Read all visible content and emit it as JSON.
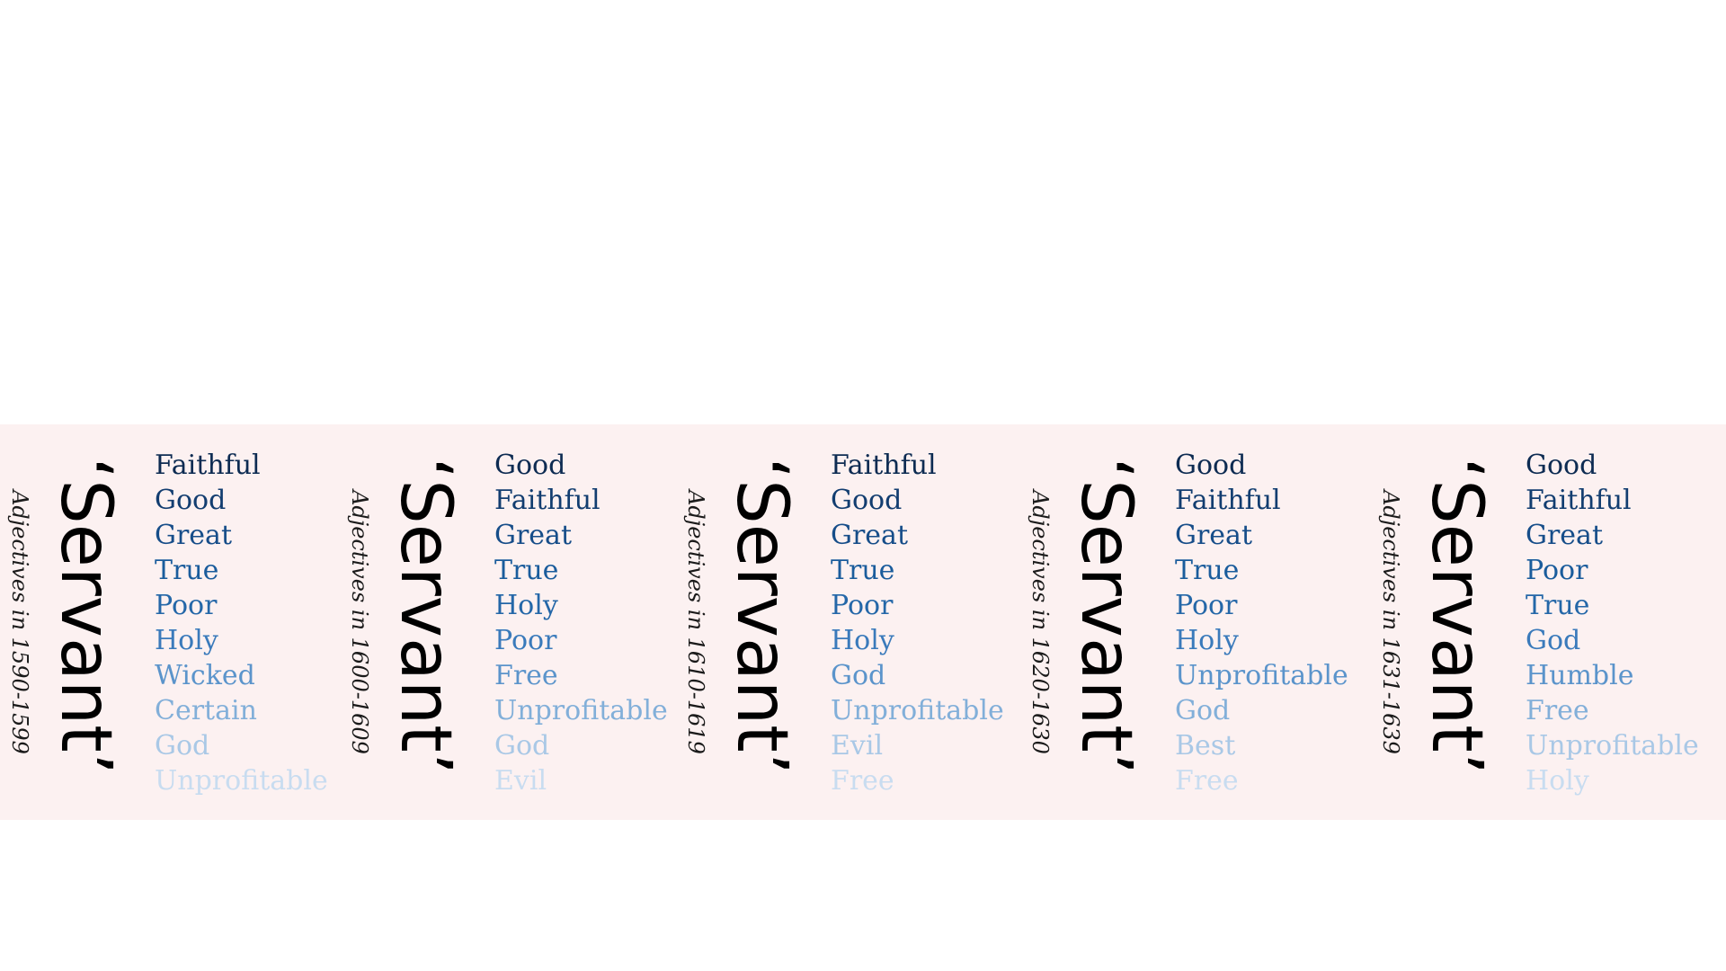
{
  "palette": [
    "#0d2b52",
    "#123d70",
    "#164d89",
    "#1a5c9c",
    "#2467a8",
    "#3a7abb",
    "#5b94cb",
    "#82afd9",
    "#a9c8e6",
    "#c8dcf0"
  ],
  "panels": [
    {
      "period": "Adjectives in 1590-1599",
      "word": "‘Servant’",
      "adjectives": [
        "Faithful",
        "Good",
        "Great",
        "True",
        "Poor",
        "Holy",
        "Wicked",
        "Certain",
        "God",
        "Unprofitable"
      ]
    },
    {
      "period": "Adjectives in 1600-1609",
      "word": "‘Servant’",
      "adjectives": [
        "Good",
        "Faithful",
        "Great",
        "True",
        "Holy",
        "Poor",
        "Free",
        "Unprofitable",
        "God",
        "Evil"
      ]
    },
    {
      "period": "Adjectives in 1610-1619",
      "word": "‘Servant’",
      "adjectives": [
        "Faithful",
        "Good",
        "Great",
        "True",
        "Poor",
        "Holy",
        "God",
        "Unprofitable",
        "Evil",
        "Free"
      ]
    },
    {
      "period": "Adjectives in 1620-1630",
      "word": "‘Servant’",
      "adjectives": [
        "Good",
        "Faithful",
        "Great",
        "True",
        "Poor",
        "Holy",
        "Unprofitable",
        "God",
        "Best",
        "Free"
      ]
    },
    {
      "period": "Adjectives in 1631-1639",
      "word": "‘Servant’",
      "adjectives": [
        "Good",
        "Faithful",
        "Great",
        "Poor",
        "True",
        "God",
        "Humble",
        "Free",
        "Unprofitable",
        "Holy"
      ]
    }
  ]
}
